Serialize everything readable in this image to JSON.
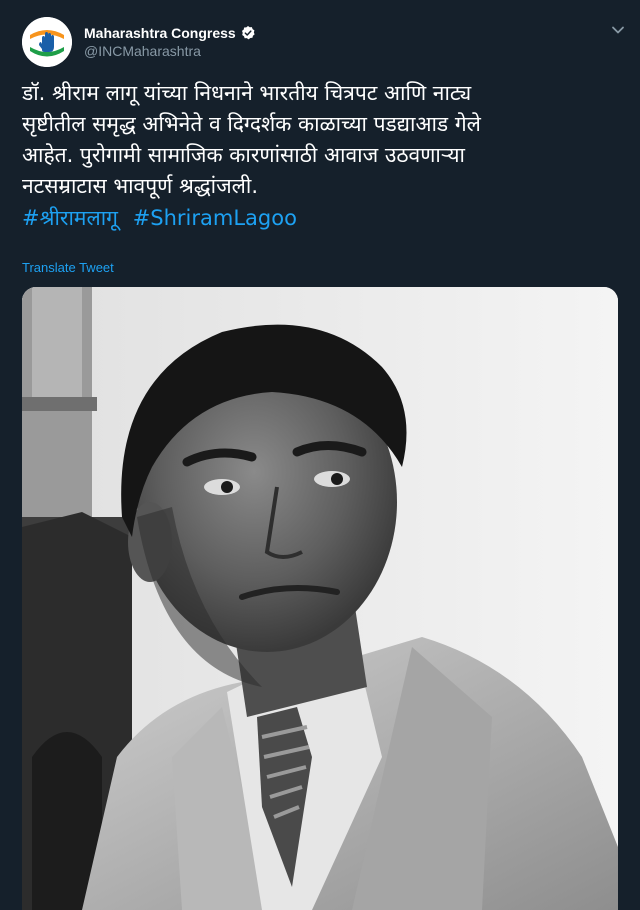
{
  "account": {
    "display_name": "Maharashtra Congress",
    "handle": "@INCMaharashtra",
    "verified": true
  },
  "tweet": {
    "lines": [
      "डॉ. श्रीराम लागू यांच्या निधनाने भारतीय चित्रपट आणि नाट्य",
      "सृष्टीतील समृद्ध अभिनेते व दिग्दर्शक काळाच्या पडद्याआड गेले",
      "आहेत. पुरोगामी सामाजिक कारणांसाठी आवाज उठवणाऱ्या",
      "नटसम्राटास भावपूर्ण श्रद्धांजली."
    ],
    "hashtags": [
      "#श्रीरामलागू",
      "#ShriramLagoo"
    ],
    "translate_label": "Translate Tweet"
  },
  "icons": {
    "verified": "verified-badge-icon",
    "menu": "chevron-down-icon",
    "avatar": "congress-hand-logo"
  },
  "colors": {
    "background": "#15202b",
    "text": "#ffffff",
    "secondary": "#8899a6",
    "accent": "#1da1f2"
  }
}
